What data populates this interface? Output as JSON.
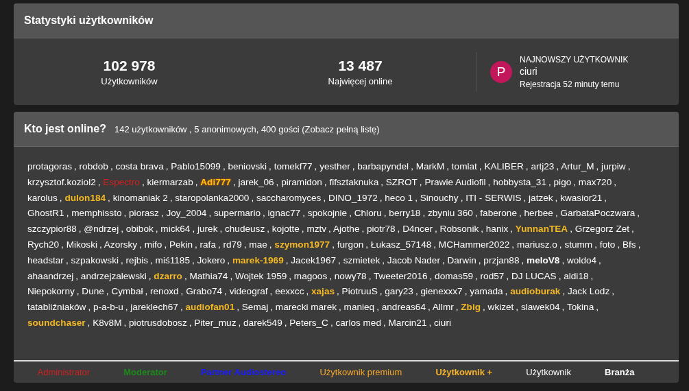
{
  "stats": {
    "title": "Statystyki użytkowników",
    "counters": [
      {
        "value": "102 978",
        "label": "Użytkowników"
      },
      {
        "value": "13 487",
        "label": "Najwięcej online"
      }
    ],
    "newest": {
      "avatar_letter": "P",
      "color": "#c2185b",
      "heading": "NAJNOWSZY UŻYTKOWNIK",
      "name": "ciuri",
      "registered": "Rejestracja 52 minuty temu"
    }
  },
  "online": {
    "title": "Kto jest online?",
    "summary": "142 użytkowników , 5 anonimowych, 400 gości (Zobacz pełną listę)",
    "separator": ",",
    "users": [
      {
        "name": "protagoras",
        "kind": "user"
      },
      {
        "name": "robdob",
        "kind": "user"
      },
      {
        "name": "costa brava",
        "kind": "user"
      },
      {
        "name": "Pablo15099",
        "kind": "user"
      },
      {
        "name": "beniovski",
        "kind": "user"
      },
      {
        "name": "tomekf77",
        "kind": "user"
      },
      {
        "name": "yesther",
        "kind": "user"
      },
      {
        "name": "barbapyndel",
        "kind": "user"
      },
      {
        "name": "MarkM",
        "kind": "user"
      },
      {
        "name": "tomlat",
        "kind": "user"
      },
      {
        "name": "KALIBER",
        "kind": "user"
      },
      {
        "name": "artj23",
        "kind": "user"
      },
      {
        "name": "Artur_M",
        "kind": "user"
      },
      {
        "name": "jurpiw",
        "kind": "user"
      },
      {
        "name": "krzysztof.koziol2",
        "kind": "user"
      },
      {
        "name": "Espectro",
        "kind": "admin"
      },
      {
        "name": "kiermarzab",
        "kind": "user"
      },
      {
        "name": "Adi777",
        "kind": "plus"
      },
      {
        "name": "jarek_06",
        "kind": "user"
      },
      {
        "name": "piramidon",
        "kind": "user"
      },
      {
        "name": "fifsztaknuka",
        "kind": "user"
      },
      {
        "name": "SZROT",
        "kind": "user"
      },
      {
        "name": "Prawie Audiofil",
        "kind": "user"
      },
      {
        "name": "hobbysta_31",
        "kind": "user"
      },
      {
        "name": "pigo",
        "kind": "user"
      },
      {
        "name": "max720",
        "kind": "user"
      },
      {
        "name": "karolus",
        "kind": "user"
      },
      {
        "name": "dulon184",
        "kind": "premium"
      },
      {
        "name": "kinomaniak 2",
        "kind": "user"
      },
      {
        "name": "staropolanka2000",
        "kind": "user"
      },
      {
        "name": "saccharomyces",
        "kind": "user"
      },
      {
        "name": "DINO_1972",
        "kind": "user"
      },
      {
        "name": "heco 1",
        "kind": "user"
      },
      {
        "name": "Sinouchy",
        "kind": "user"
      },
      {
        "name": "ITI - SERWIS",
        "kind": "user"
      },
      {
        "name": "jatzek",
        "kind": "user"
      },
      {
        "name": "kwasior21",
        "kind": "user"
      },
      {
        "name": "GhostR1",
        "kind": "user"
      },
      {
        "name": "memphissto",
        "kind": "user"
      },
      {
        "name": "piorasz",
        "kind": "user"
      },
      {
        "name": "Joy_2004",
        "kind": "user"
      },
      {
        "name": "supermario",
        "kind": "user"
      },
      {
        "name": "ignac77",
        "kind": "user"
      },
      {
        "name": "spokojnie",
        "kind": "user"
      },
      {
        "name": "Chloru",
        "kind": "user"
      },
      {
        "name": "berry18",
        "kind": "user"
      },
      {
        "name": "zbyniu 360",
        "kind": "user"
      },
      {
        "name": "faberone",
        "kind": "user"
      },
      {
        "name": "herbee",
        "kind": "user"
      },
      {
        "name": "GarbataPoczwara",
        "kind": "user"
      },
      {
        "name": "szczypior88",
        "kind": "user"
      },
      {
        "name": "@ndrzej",
        "kind": "user"
      },
      {
        "name": "obibok",
        "kind": "user"
      },
      {
        "name": "mick64",
        "kind": "user"
      },
      {
        "name": "jurek",
        "kind": "user"
      },
      {
        "name": "chudeusz",
        "kind": "user"
      },
      {
        "name": "kojotte",
        "kind": "user"
      },
      {
        "name": "mztv",
        "kind": "user"
      },
      {
        "name": "Ajothe",
        "kind": "user"
      },
      {
        "name": "piotr78",
        "kind": "user"
      },
      {
        "name": "D4ncer",
        "kind": "user"
      },
      {
        "name": "Robsonik",
        "kind": "user"
      },
      {
        "name": "hanix",
        "kind": "user"
      },
      {
        "name": "YunnanTEA",
        "kind": "premium"
      },
      {
        "name": "Grzegorz Zet",
        "kind": "user"
      },
      {
        "name": "Rych20",
        "kind": "user"
      },
      {
        "name": "Mikoski",
        "kind": "user"
      },
      {
        "name": "Azorsky",
        "kind": "user"
      },
      {
        "name": "mifo",
        "kind": "user"
      },
      {
        "name": "Pekin",
        "kind": "user"
      },
      {
        "name": "rafa",
        "kind": "user"
      },
      {
        "name": "rd79",
        "kind": "user"
      },
      {
        "name": "mae",
        "kind": "user"
      },
      {
        "name": "szymon1977",
        "kind": "premium"
      },
      {
        "name": "furgon",
        "kind": "user"
      },
      {
        "name": "Łukasz_57148",
        "kind": "user"
      },
      {
        "name": "MCHammer2022",
        "kind": "user"
      },
      {
        "name": "mariusz.o",
        "kind": "user"
      },
      {
        "name": "stumm",
        "kind": "user"
      },
      {
        "name": "foto",
        "kind": "user"
      },
      {
        "name": "Bfs",
        "kind": "user"
      },
      {
        "name": "headstar",
        "kind": "user"
      },
      {
        "name": "szpakowski",
        "kind": "user"
      },
      {
        "name": "rejbis",
        "kind": "user"
      },
      {
        "name": "miś1185",
        "kind": "user"
      },
      {
        "name": "Jokero",
        "kind": "user"
      },
      {
        "name": "marek-1969",
        "kind": "premium"
      },
      {
        "name": "Jacek1967",
        "kind": "user"
      },
      {
        "name": "szmietek",
        "kind": "user"
      },
      {
        "name": "Jacob Nader",
        "kind": "user"
      },
      {
        "name": "Darwin",
        "kind": "user"
      },
      {
        "name": "przjan88",
        "kind": "user"
      },
      {
        "name": "meloV8",
        "kind": "industry"
      },
      {
        "name": "woldo4",
        "kind": "user"
      },
      {
        "name": "ahaandrzej",
        "kind": "user"
      },
      {
        "name": "andrzejzalewski",
        "kind": "user"
      },
      {
        "name": "dzarro",
        "kind": "premium"
      },
      {
        "name": "Mathia74",
        "kind": "user"
      },
      {
        "name": "Wojtek 1959",
        "kind": "user"
      },
      {
        "name": "magoos",
        "kind": "user"
      },
      {
        "name": "nowy78",
        "kind": "user"
      },
      {
        "name": "Tweeter2016",
        "kind": "user"
      },
      {
        "name": "domas59",
        "kind": "user"
      },
      {
        "name": "rod57",
        "kind": "user"
      },
      {
        "name": "DJ LUCAS",
        "kind": "user"
      },
      {
        "name": "aldi18",
        "kind": "user"
      },
      {
        "name": "Niepokorny",
        "kind": "user"
      },
      {
        "name": "Dune",
        "kind": "user"
      },
      {
        "name": "Cymbał",
        "kind": "user"
      },
      {
        "name": "renoxd",
        "kind": "user"
      },
      {
        "name": "Grabo74",
        "kind": "user"
      },
      {
        "name": "videograf",
        "kind": "user"
      },
      {
        "name": "eexxcc",
        "kind": "user"
      },
      {
        "name": "xajas",
        "kind": "premium"
      },
      {
        "name": "PiotruuS",
        "kind": "user"
      },
      {
        "name": "gary23",
        "kind": "user"
      },
      {
        "name": "gienexxx7",
        "kind": "user"
      },
      {
        "name": "yamada",
        "kind": "user"
      },
      {
        "name": "audioburak",
        "kind": "premium"
      },
      {
        "name": "Jack Lodz",
        "kind": "user"
      },
      {
        "name": "tatabliźniaków",
        "kind": "user"
      },
      {
        "name": "p-a-b-u",
        "kind": "user"
      },
      {
        "name": "jareklech67",
        "kind": "user"
      },
      {
        "name": "audiofan01",
        "kind": "premium"
      },
      {
        "name": "Semaj",
        "kind": "user"
      },
      {
        "name": "marecki marek",
        "kind": "user"
      },
      {
        "name": "manieq",
        "kind": "user"
      },
      {
        "name": "andreas64",
        "kind": "user"
      },
      {
        "name": "Allmr",
        "kind": "user"
      },
      {
        "name": "Zbig",
        "kind": "premium"
      },
      {
        "name": "wkizet",
        "kind": "user"
      },
      {
        "name": "slawek04",
        "kind": "user"
      },
      {
        "name": "Tokina",
        "kind": "user"
      },
      {
        "name": "soundchaser",
        "kind": "premium"
      },
      {
        "name": "K8v8M",
        "kind": "user"
      },
      {
        "name": "piotrusdobosz",
        "kind": "user"
      },
      {
        "name": "Piter_muz",
        "kind": "user"
      },
      {
        "name": "darek549",
        "kind": "user"
      },
      {
        "name": "Peters_C",
        "kind": "user"
      },
      {
        "name": "carlos med",
        "kind": "user"
      },
      {
        "name": "Marcin21",
        "kind": "user"
      },
      {
        "name": "ciuri",
        "kind": "user"
      }
    ],
    "legend": [
      {
        "label": "Administrator",
        "kind": "admin"
      },
      {
        "label": "Moderator",
        "kind": "moderator"
      },
      {
        "label": "Partner Audiostereo",
        "kind": "partner"
      },
      {
        "label": "Użytkownik premium",
        "kind": "premium_legend"
      },
      {
        "label": "Użytkownik +",
        "kind": "plus_legend"
      },
      {
        "label": "Użytkownik",
        "kind": "user"
      },
      {
        "label": "Branża",
        "kind": "industry"
      }
    ]
  }
}
